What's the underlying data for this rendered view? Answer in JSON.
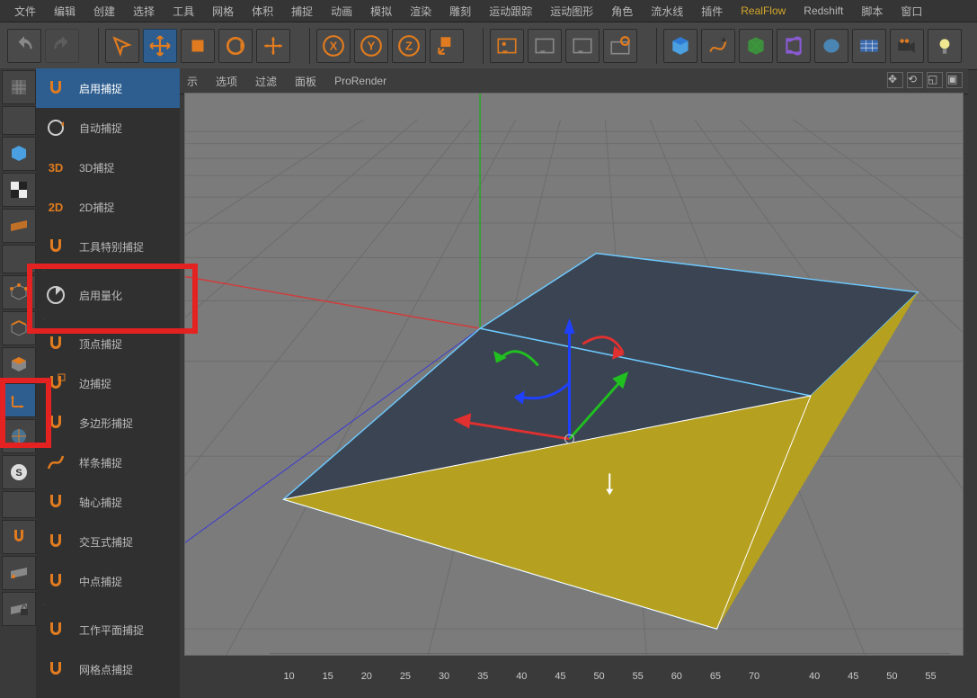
{
  "menu": {
    "items": [
      "文件",
      "编辑",
      "创建",
      "选择",
      "工具",
      "网格",
      "体积",
      "捕捉",
      "动画",
      "模拟",
      "渲染",
      "雕刻",
      "运动跟踪",
      "运动图形",
      "角色",
      "流水线",
      "插件",
      "RealFlow",
      "Redshift",
      "脚本",
      "窗口"
    ],
    "hot": 17
  },
  "viewheader": {
    "items": [
      "示",
      "选项",
      "过滤",
      "面板",
      "ProRender"
    ]
  },
  "snapmenu": {
    "items": [
      {
        "label": "启用捕捉",
        "icon": "magnet",
        "sel": true
      },
      {
        "label": "自动捕捉",
        "icon": "circle-arrow"
      },
      {
        "label": "3D捕捉",
        "icon": "3d"
      },
      {
        "label": "2D捕捉",
        "icon": "2d"
      },
      {
        "label": "工具特别捕捉",
        "icon": "magnet"
      },
      {
        "sep": true
      },
      {
        "label": "启用量化",
        "icon": "pie",
        "highlight": true
      },
      {
        "sep": true
      },
      {
        "label": "顶点捕捉",
        "icon": "magnet"
      },
      {
        "label": "边捕捉",
        "icon": "magnet-sq"
      },
      {
        "label": "多边形捕捉",
        "icon": "magnet"
      },
      {
        "label": "样条捕捉",
        "icon": "curve"
      },
      {
        "label": "轴心捕捉",
        "icon": "magnet"
      },
      {
        "label": "交互式捕捉",
        "icon": "magnet"
      },
      {
        "label": "中点捕捉",
        "icon": "magnet"
      },
      {
        "sep": true
      },
      {
        "label": "工作平面捕捉",
        "icon": "magnet"
      },
      {
        "label": "网格点捕捉",
        "icon": "magnet"
      }
    ]
  },
  "ruler": {
    "ticks": [
      10,
      15,
      20,
      25,
      30,
      35,
      40,
      45,
      50,
      55,
      60,
      65,
      70,
      "",
      40,
      45,
      50,
      55
    ]
  }
}
